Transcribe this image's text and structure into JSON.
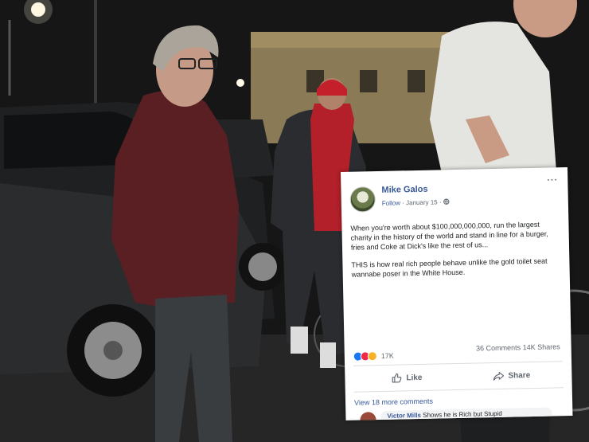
{
  "post": {
    "author": "Mike Galos",
    "follow": "Follow",
    "separator": "·",
    "date": "January 15",
    "sep2": "·",
    "menu": "···",
    "paragraphs": [
      "When you're worth about $100,000,000,000, run the largest charity in the history of the world and stand in line for a burger, fries and Coke at Dick's like the rest of us...",
      "THIS is how real rich people behave unlike the gold toilet seat wannabe poser in the White House."
    ],
    "reaction_count": "17K",
    "comments": "36 Comments",
    "shares": "14K Shares",
    "like_label": "Like",
    "share_label": "Share",
    "view_more": "View 18 more comments",
    "comment_preview_author": "Victor Mills",
    "comment_preview_text": "Shows he is Rich but Stupid"
  },
  "colors": {
    "fb_blue": "#385898",
    "like_blue": "#1877f2",
    "love_red": "#f0284a",
    "haha_yellow": "#f7b125"
  }
}
